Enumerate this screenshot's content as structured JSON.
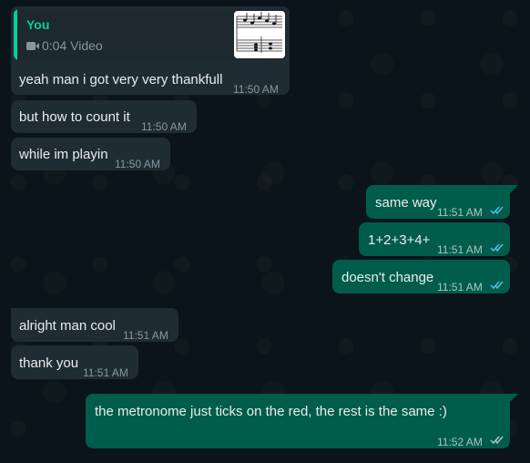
{
  "quote": {
    "author": "You",
    "media_label": "0:04 Video",
    "thumbnail": "sheet-music-thumbnail"
  },
  "messages": [
    {
      "text": "yeah man i got very very thankfull",
      "time": "11:50 AM",
      "dir": "in"
    },
    {
      "text": "but how to count it",
      "time": "11:50 AM",
      "dir": "in"
    },
    {
      "text": "while im playin",
      "time": "11:50 AM",
      "dir": "in"
    },
    {
      "text": "same way",
      "time": "11:51 AM",
      "dir": "out"
    },
    {
      "text": "1+2+3+4+",
      "time": "11:51 AM",
      "dir": "out"
    },
    {
      "text": "doesn't change",
      "time": "11:51 AM",
      "dir": "out"
    },
    {
      "text": "alright man cool",
      "time": "11:51 AM",
      "dir": "in"
    },
    {
      "text": "thank you",
      "time": "11:51 AM",
      "dir": "in"
    },
    {
      "text": "the metronome just ticks on the red, the rest is the same :)",
      "time": "11:52 AM",
      "dir": "out",
      "read": false
    }
  ],
  "colors": {
    "background": "#0b141a",
    "incoming_bubble": "#202c33",
    "outgoing_bubble": "#005c4b",
    "read_ticks": "#53bdeb",
    "quote_accent": "#06cf9c"
  },
  "icons": [
    "video-icon",
    "double-check-icon"
  ]
}
